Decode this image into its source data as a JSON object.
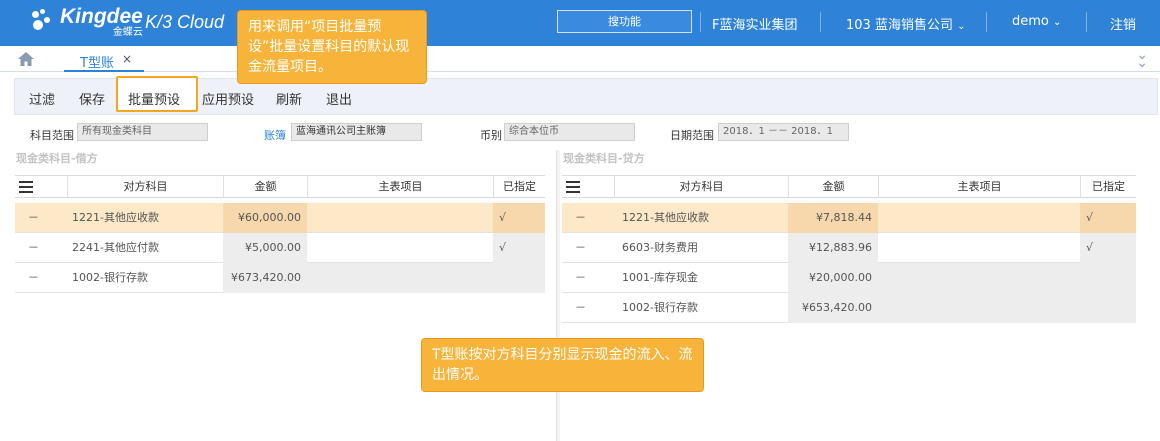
{
  "header": {
    "brand": "Kingdee",
    "brand_sub": "金蝶云",
    "product": "K/3 Cloud",
    "search_placeholder": "搜功能",
    "group": "F蓝海实业集团",
    "org": "103 蓝海销售公司",
    "user": "demo",
    "logout": "注销",
    "color": "#2e83d8"
  },
  "tabs": [
    {
      "label": "T型账",
      "close": "×"
    }
  ],
  "toolbar": {
    "filter": "过滤",
    "save": "保存",
    "batch_preset": "批量预设",
    "apply_preset": "应用预设",
    "refresh": "刷新",
    "exit": "退出"
  },
  "filters": {
    "account_range_label": "科目范围",
    "account_range_value": "所有现金类科目",
    "book_label": "账簿",
    "book_value": "蓝海通讯公司主账簿",
    "currency_label": "币别",
    "currency_value": "综合本位币",
    "date_label": "日期范围",
    "date_value": "2018．1 －－ 2018．1"
  },
  "debit": {
    "title": "现金类科目-借方",
    "headers": [
      "对方科目",
      "金额",
      "主表项目",
      "已指定"
    ],
    "rows": [
      {
        "mark": "－",
        "account": "1221-其他应收款",
        "amount": "¥60,000.00",
        "item": "",
        "assigned": "√"
      },
      {
        "mark": "－",
        "account": "2241-其他应付款",
        "amount": "¥5,000.00",
        "item": "",
        "assigned": "√"
      },
      {
        "mark": "－",
        "account": "1002-银行存款",
        "amount": "¥673,420.00",
        "item": "",
        "assigned": ""
      }
    ]
  },
  "credit": {
    "title": "现金类科目-贷方",
    "headers": [
      "对方科目",
      "金额",
      "主表项目",
      "已指定"
    ],
    "rows": [
      {
        "mark": "－",
        "account": "1221-其他应收款",
        "amount": "¥7,818.44",
        "item": "",
        "assigned": "√"
      },
      {
        "mark": "－",
        "account": "6603-财务费用",
        "amount": "¥12,883.96",
        "item": "",
        "assigned": "√"
      },
      {
        "mark": "－",
        "account": "1001-库存现金",
        "amount": "¥20,000.00",
        "item": "",
        "assigned": ""
      },
      {
        "mark": "－",
        "account": "1002-银行存款",
        "amount": "¥653,420.00",
        "item": "",
        "assigned": ""
      }
    ]
  },
  "callouts": {
    "top": "用来调用“项目批量预设”批量设置科目的默认现金流量项目。",
    "bottom": "T型账按对方科目分别显示现金的流入、流出情况。"
  }
}
